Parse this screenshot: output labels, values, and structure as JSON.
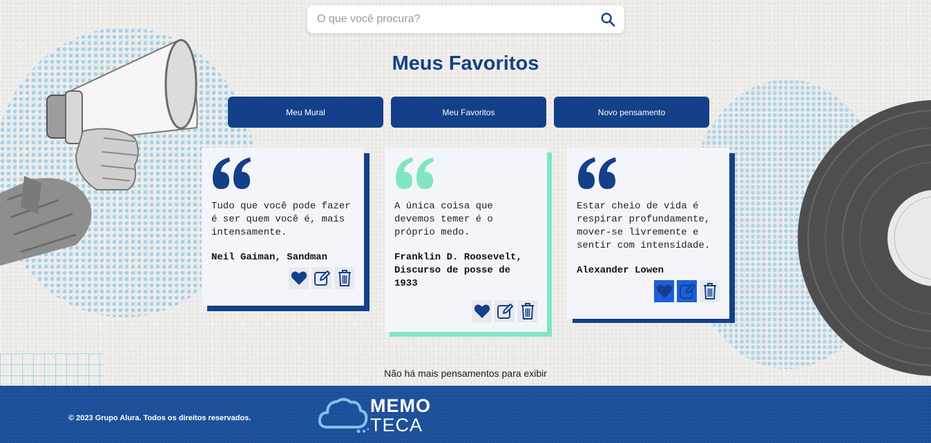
{
  "search": {
    "placeholder": "O que você procura?",
    "icon": "search-icon"
  },
  "page": {
    "title": "Meus Favoritos"
  },
  "nav": [
    {
      "label": "Meu Mural"
    },
    {
      "label": "Meu Favoritos"
    },
    {
      "label": "Novo pensamento"
    }
  ],
  "cards": [
    {
      "text": "Tudo que você pode fazer é ser quem você é, mais intensamente.",
      "author": "Neil Gaiman, Sandman",
      "accent": "#134088",
      "quote_color": "#134088",
      "favorite": true
    },
    {
      "text": "A única coisa que devemos temer é o próprio medo.",
      "author": "Franklin D. Roosevelt, Discurso de posse de 1933",
      "accent": "#80e6c2",
      "quote_color": "#80e6c2",
      "favorite": true
    },
    {
      "text": "Estar cheio de vida é respirar profundamente, mover-se livremente e sentir com intensidade.",
      "author": "Alexander Lowen",
      "accent": "#134088",
      "quote_color": "#134088",
      "favorite": true
    }
  ],
  "status": {
    "empty_message": "Não há mais pensamentos para exibir"
  },
  "footer": {
    "copyright": "© 2023 Grupo Alura. Todos os direitos reservados.",
    "logo_top": "MEMO",
    "logo_bottom": "TECA"
  },
  "colors": {
    "primary": "#134088",
    "mint": "#80e6c2",
    "footer": "#1b4f99",
    "active_action": "#1b5fe0"
  }
}
